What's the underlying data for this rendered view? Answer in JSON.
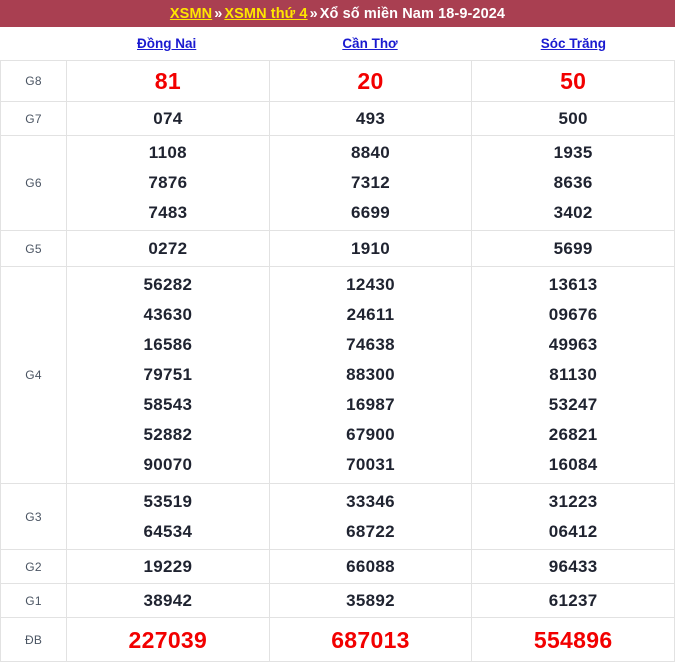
{
  "header": {
    "link1": "XSMN",
    "sep": "»",
    "link2": "XSMN thứ 4",
    "title_rest": "Xổ số miền Nam 18-9-2024",
    "background_color": "#a93f51",
    "link_color": "#ffe600",
    "text_color": "#ffffff"
  },
  "columns": [
    {
      "name": "Đồng Nai"
    },
    {
      "name": "Cần Thơ"
    },
    {
      "name": "Sóc Trăng"
    }
  ],
  "colors": {
    "prize_highlight": "#f20000",
    "normal_text": "#1f2330",
    "label_text": "#4b5563",
    "link_blue": "#1a1ad0",
    "border": "#e2e2e2"
  },
  "rows": [
    {
      "label": "G8",
      "highlight": true,
      "values": [
        [
          "81"
        ],
        [
          "20"
        ],
        [
          "50"
        ]
      ]
    },
    {
      "label": "G7",
      "highlight": false,
      "values": [
        [
          "074"
        ],
        [
          "493"
        ],
        [
          "500"
        ]
      ]
    },
    {
      "label": "G6",
      "highlight": false,
      "values": [
        [
          "1108",
          "7876",
          "7483"
        ],
        [
          "8840",
          "7312",
          "6699"
        ],
        [
          "1935",
          "8636",
          "3402"
        ]
      ]
    },
    {
      "label": "G5",
      "highlight": false,
      "values": [
        [
          "0272"
        ],
        [
          "1910"
        ],
        [
          "5699"
        ]
      ]
    },
    {
      "label": "G4",
      "highlight": false,
      "values": [
        [
          "56282",
          "43630",
          "16586",
          "79751",
          "58543",
          "52882",
          "90070"
        ],
        [
          "12430",
          "24611",
          "74638",
          "88300",
          "16987",
          "67900",
          "70031"
        ],
        [
          "13613",
          "09676",
          "49963",
          "81130",
          "53247",
          "26821",
          "16084"
        ]
      ]
    },
    {
      "label": "G3",
      "highlight": false,
      "values": [
        [
          "53519",
          "64534"
        ],
        [
          "33346",
          "68722"
        ],
        [
          "31223",
          "06412"
        ]
      ]
    },
    {
      "label": "G2",
      "highlight": false,
      "values": [
        [
          "19229"
        ],
        [
          "66088"
        ],
        [
          "96433"
        ]
      ]
    },
    {
      "label": "G1",
      "highlight": false,
      "values": [
        [
          "38942"
        ],
        [
          "35892"
        ],
        [
          "61237"
        ]
      ]
    },
    {
      "label": "ĐB",
      "highlight": true,
      "values": [
        [
          "227039"
        ],
        [
          "687013"
        ],
        [
          "554896"
        ]
      ]
    }
  ]
}
